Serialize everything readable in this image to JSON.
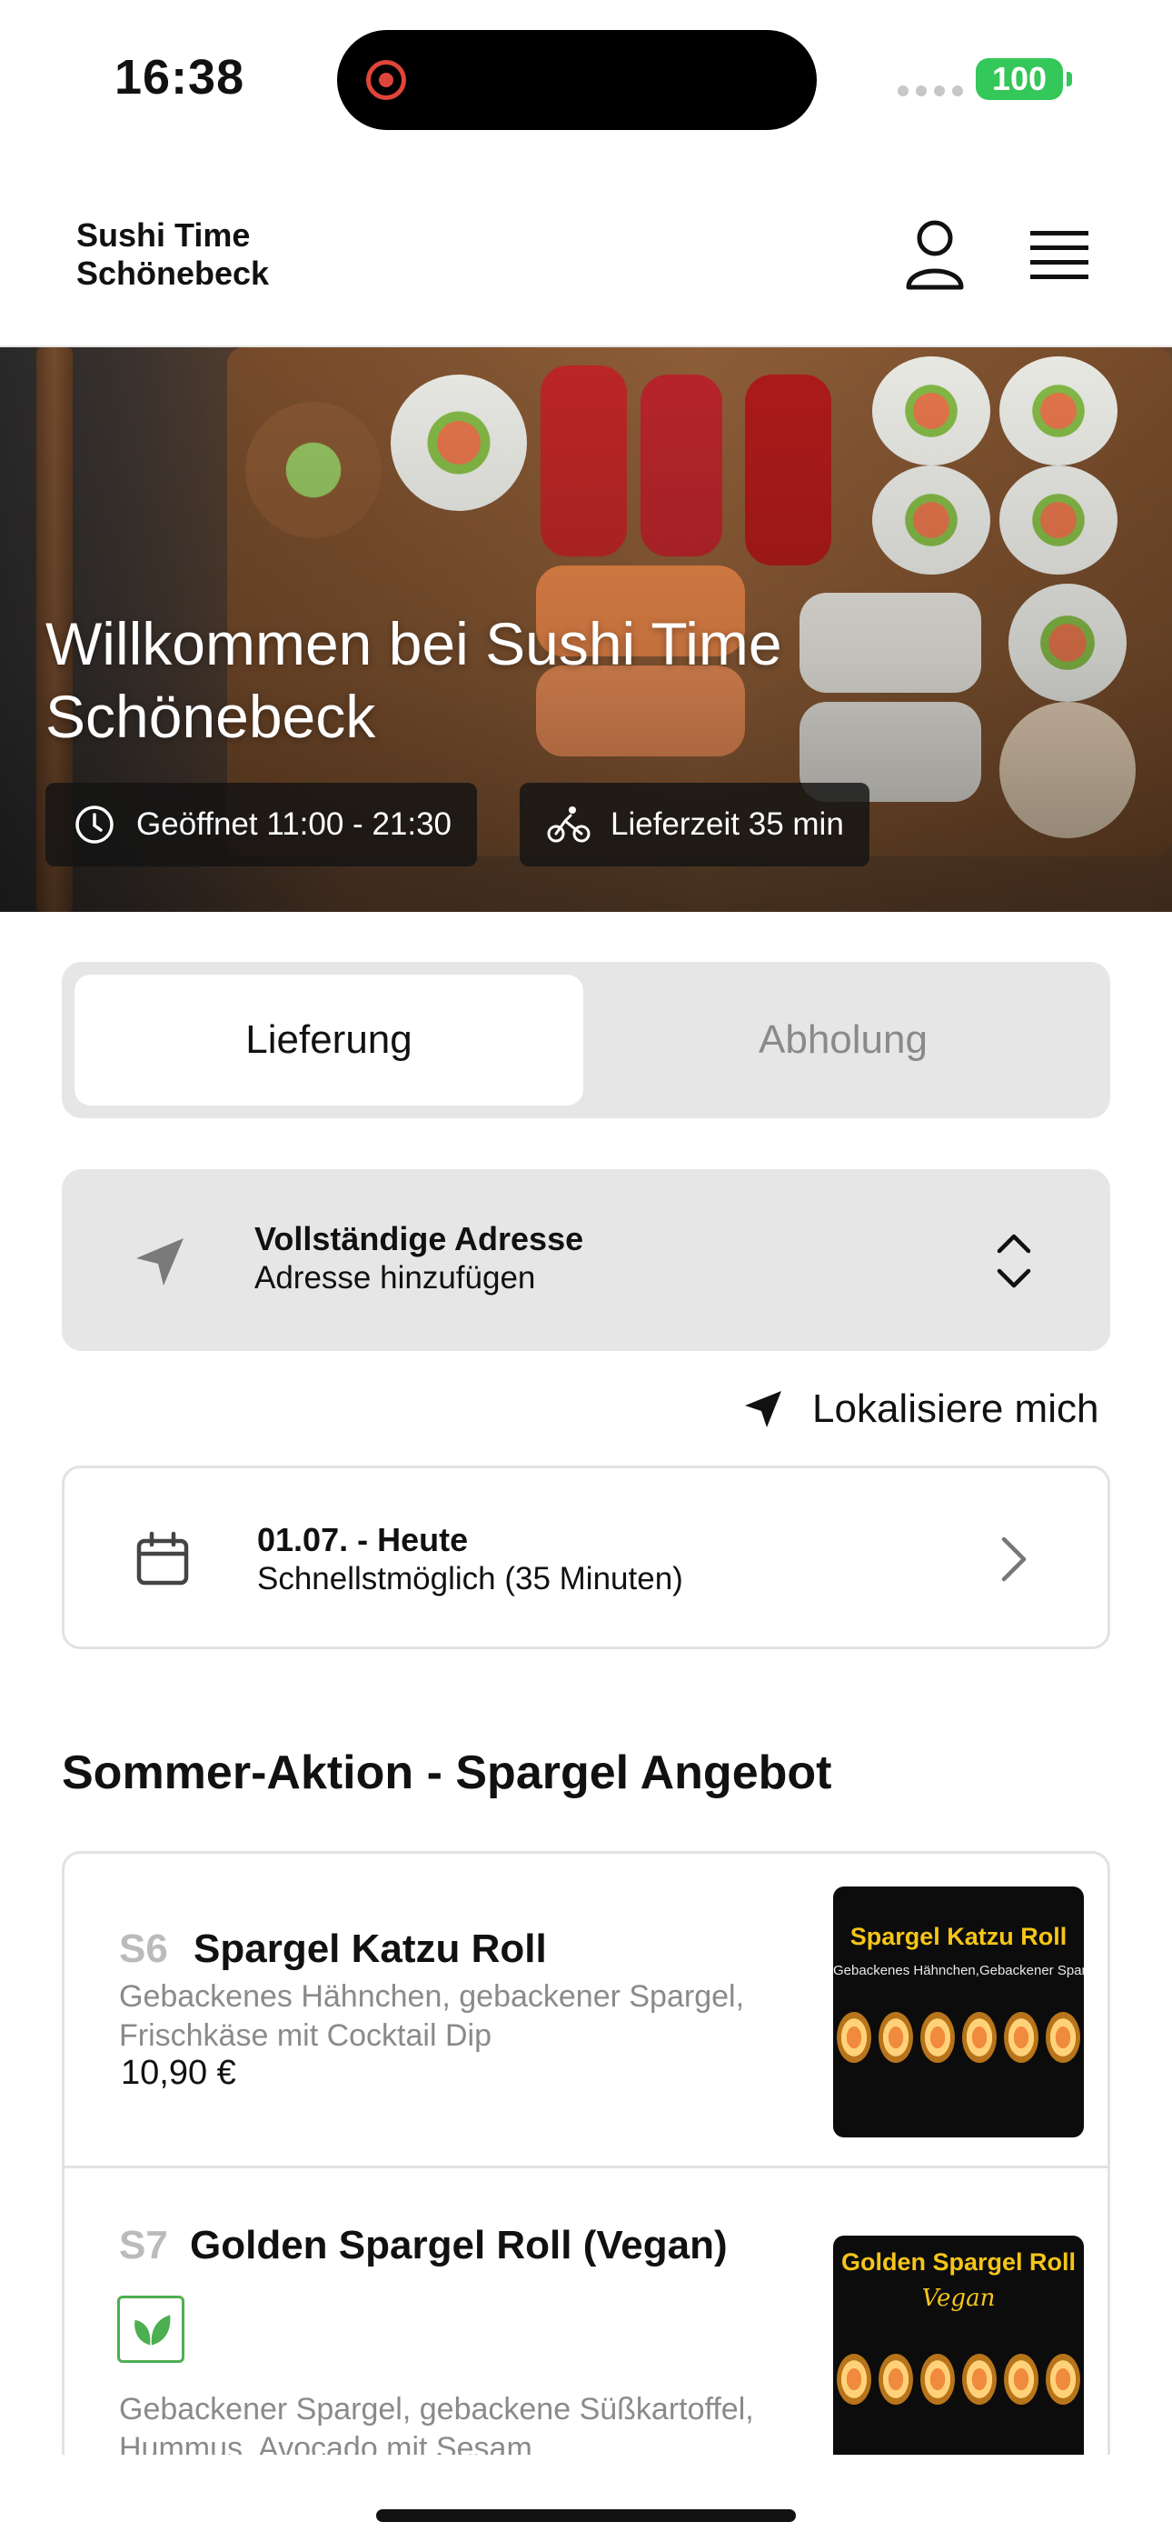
{
  "status": {
    "time": "16:38",
    "battery": "100"
  },
  "header": {
    "brand": "Sushi Time Schönebeck",
    "user_icon": "user-icon",
    "menu_icon": "hamburger-menu-icon"
  },
  "hero": {
    "title": "Willkommen bei Sushi Time Schönebeck",
    "hours": "Geöffnet 11:00 - 21:30",
    "delivery_time": "Lieferzeit 35 min"
  },
  "mode_toggle": {
    "options": [
      "Lieferung",
      "Abholung"
    ],
    "selected": "Lieferung"
  },
  "address": {
    "title": "Vollständige Adresse",
    "placeholder": "Adresse hinzufügen"
  },
  "locate_me": "Lokalisiere mich",
  "schedule": {
    "date": "01.07. - Heute",
    "time": "Schnellstmöglich (35 Minuten)"
  },
  "section": {
    "title": "Sommer-Aktion - Spargel Angebot",
    "items": [
      {
        "code": "S6",
        "name": "Spargel Katzu Roll",
        "description": "Gebackenes Hähnchen, gebackener Spargel, Frischkäse mit Cocktail Dip",
        "price": "10,90 €",
        "image_title": "Spargel Katzu Roll",
        "image_subtitle": "Gebackenes Hähnchen,Gebackener Spargel, Frischkäse mit Cocktail Dip"
      },
      {
        "code": "S7",
        "name": "Golden Spargel Roll (Vegan)",
        "description": "Gebackener Spargel, gebackene Süßkartoffel, Hummus, Avocado mit Sesam",
        "image_title": "Golden Spargel Roll",
        "image_subtitle": "Vegan"
      }
    ]
  },
  "colors": {
    "vegan_green": "#4caf50",
    "accent_dark": "#111111",
    "battery_green": "#34c759"
  }
}
